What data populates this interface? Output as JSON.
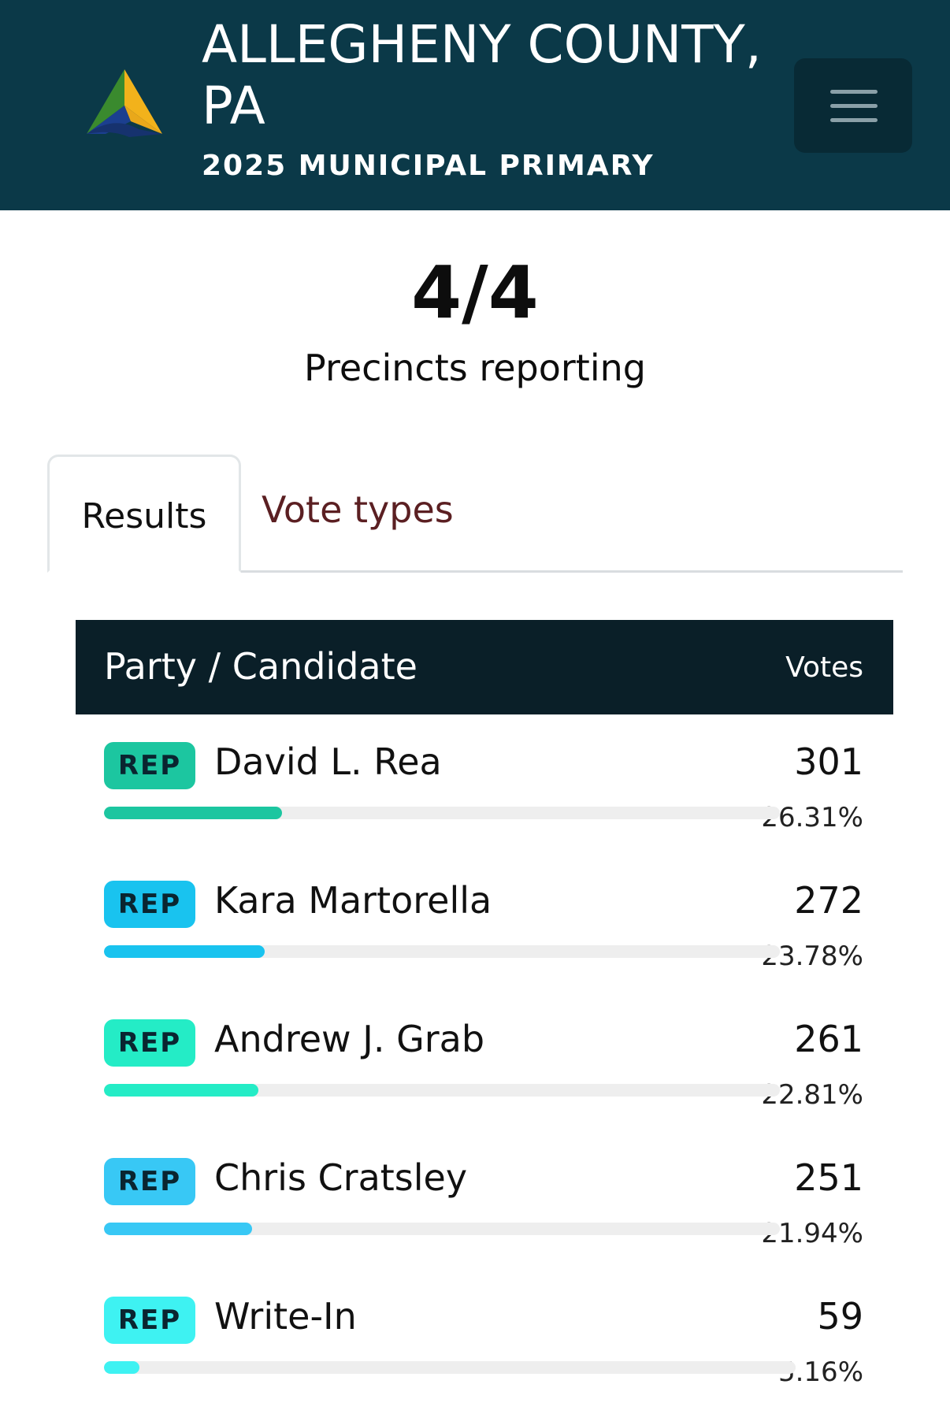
{
  "header": {
    "title": "ALLEGHENY COUNTY, PA",
    "subtitle": "2025 MUNICIPAL PRIMARY",
    "logo_icon": "allegheny-county-logo",
    "menu_icon": "hamburger-menu-icon"
  },
  "precincts": {
    "count": "4/4",
    "label": "Precincts reporting"
  },
  "tabs": [
    {
      "label": "Results",
      "active": true
    },
    {
      "label": "Vote types",
      "active": false
    }
  ],
  "table": {
    "header_left": "Party / Candidate",
    "header_right": "Votes",
    "rows": [
      {
        "party": "REP",
        "name": "David L. Rea",
        "votes": "301",
        "percent": "26.31%",
        "share": 0.2631,
        "color": "#1cc6a0"
      },
      {
        "party": "REP",
        "name": "Kara Martorella",
        "votes": "272",
        "percent": "23.78%",
        "share": 0.2378,
        "color": "#19c3ef"
      },
      {
        "party": "REP",
        "name": "Andrew J. Grab",
        "votes": "261",
        "percent": "22.81%",
        "share": 0.2281,
        "color": "#24ecc6"
      },
      {
        "party": "REP",
        "name": "Chris Cratsley",
        "votes": "251",
        "percent": "21.94%",
        "share": 0.2194,
        "color": "#38c8f5"
      },
      {
        "party": "REP",
        "name": "Write-In",
        "votes": "59",
        "percent": "5.16%",
        "share": 0.0516,
        "color": "#3ef2f2"
      }
    ]
  }
}
